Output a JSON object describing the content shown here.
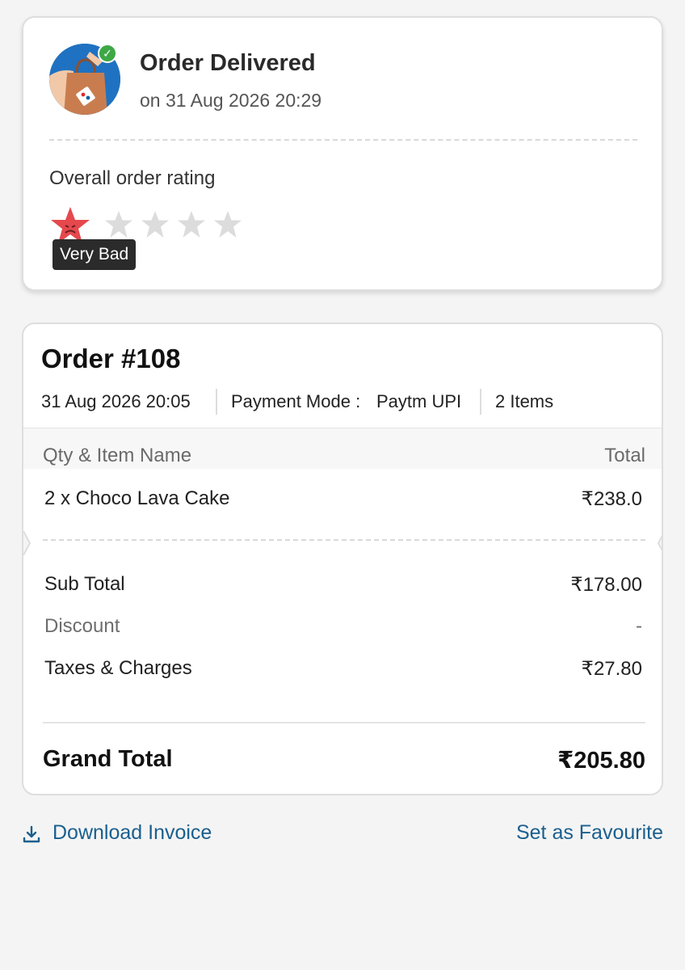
{
  "status": {
    "title": "Order Delivered",
    "time": "on 31 Aug 2026 20:29",
    "rating_label": "Overall order rating",
    "rating": 1,
    "rating_max": 5,
    "rating_tooltip": "Very Bad"
  },
  "order": {
    "title": "Order #108",
    "date": "31 Aug 2026 20:05",
    "payment_label": "Payment Mode :",
    "payment_value": "Paytm UPI",
    "items_count": "2 Items",
    "col_item": "Qty & Item Name",
    "col_total": "Total",
    "items": [
      {
        "name": "2 x Choco Lava Cake",
        "total": "₹238.0"
      }
    ],
    "sub_total_label": "Sub Total",
    "sub_total_value": "₹178.00",
    "discount_label": "Discount",
    "discount_value": "-",
    "taxes_label": "Taxes & Charges",
    "taxes_value": "₹27.80",
    "grand_total_label": "Grand Total",
    "grand_total_value": "₹205.80"
  },
  "actions": {
    "download_label": "Download Invoice",
    "favourite_label": "Set as Favourite"
  },
  "colors": {
    "accent": "#1a5f8e",
    "rating_red": "#e5484d",
    "star_empty": "#dcdcdc",
    "delivered_green": "#3ea845"
  },
  "icons": {
    "avatar": "delivery-bag-icon",
    "check": "check-icon",
    "download": "download-icon"
  }
}
